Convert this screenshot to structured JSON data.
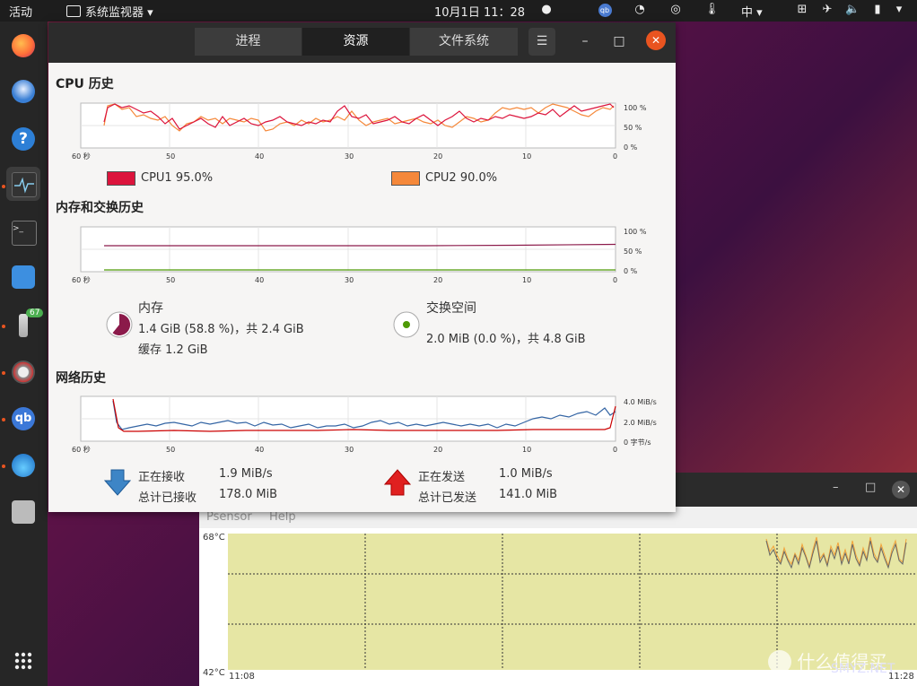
{
  "topbar": {
    "activities": "活动",
    "app_menu": "系统监视器",
    "datetime": "10月1日  11：28",
    "input_method": "中"
  },
  "dock": {
    "items": [
      "firefox",
      "thunderbird",
      "help",
      "system-monitor",
      "terminal",
      "software",
      "app-67",
      "app-badge",
      "qbittorrent",
      "app-drop",
      "disk"
    ],
    "badge_count": "67"
  },
  "sysmon": {
    "tabs": [
      "进程",
      "资源",
      "文件系统"
    ],
    "active_tab": "资源",
    "cpu": {
      "title": "CPU 历史",
      "x_ticks": [
        "60 秒",
        "50",
        "40",
        "30",
        "20",
        "10",
        "0"
      ],
      "y_ticks": [
        "100 %",
        "50 %",
        "0 %"
      ],
      "cpu1_label": "CPU1  95.0%",
      "cpu2_label": "CPU2  90.0%",
      "cpu1_color": "#dc143c",
      "cpu2_color": "#f5883a"
    },
    "memory": {
      "title": "内存和交换历史",
      "x_ticks": [
        "60 秒",
        "50",
        "40",
        "30",
        "20",
        "10",
        "0"
      ],
      "y_ticks": [
        "100 %",
        "50 %",
        "0 %"
      ],
      "mem_title": "内存",
      "mem_usage": "1.4 GiB (58.8 %)，共 2.4 GiB",
      "mem_cache": "缓存 1.2 GiB",
      "swap_title": "交换空间",
      "swap_usage": "2.0 MiB (0.0 %)，共 4.8 GiB",
      "mem_color": "#8b1a4a",
      "swap_color": "#4e9a06"
    },
    "network": {
      "title": "网络历史",
      "x_ticks": [
        "60 秒",
        "50",
        "40",
        "30",
        "20",
        "10",
        "0"
      ],
      "y_ticks": [
        "4.0 MiB/s",
        "2.0 MiB/s",
        "0 字节/s"
      ],
      "recv_label": "正在接收",
      "recv_value": "1.9 MiB/s",
      "recv_total_label": "总计已接收",
      "recv_total_value": "178.0 MiB",
      "send_label": "正在发送",
      "send_value": "1.0 MiB/s",
      "send_total_label": "总计已发送",
      "send_total_value": "141.0 MiB",
      "recv_color": "#3465a4",
      "send_color": "#cc0000"
    }
  },
  "psensor": {
    "menu": [
      "Psensor",
      "Help"
    ],
    "y_top": "68°C",
    "y_bottom": "42°C",
    "x_left": "11:08",
    "x_right": "11:28"
  },
  "watermark": "什么值得买",
  "watermark_sub": "SMYZ.NET"
}
